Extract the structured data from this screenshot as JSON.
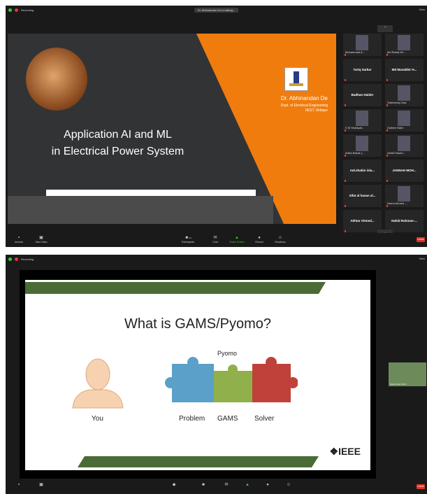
{
  "screens": [
    {
      "recording_label": "Recording",
      "meeting_title": "Dr. Abhinandan De is talking...",
      "view_label": "View",
      "slide": {
        "title_line1": "Application AI and ML",
        "title_line2": "in Electrical Power System",
        "author": "Dr. Abhinandan De",
        "dept_line1": "Dept. of Electrical Engineering",
        "dept_line2": "IIEST, Shibpur"
      },
      "participants": [
        {
          "name": "Mohammad A...",
          "video": true
        },
        {
          "name": "Md Rahat Kh...",
          "video": true
        },
        {
          "name": "Tariq Sarkar",
          "video": false
        },
        {
          "name": "Md Masabbir H...",
          "video": false
        },
        {
          "name": "Badhan Haider",
          "video": false
        },
        {
          "name": "Subhamoy Das",
          "video": true
        },
        {
          "name": "S M Shafayat...",
          "video": true
        },
        {
          "name": "Gulfam Naim",
          "video": true
        },
        {
          "name": "Aritra Basak (...",
          "video": true
        },
        {
          "name": "Zahid Hasan...",
          "video": true
        },
        {
          "name": "md.shabin isla...",
          "video": false
        },
        {
          "name": "JANNAH MOH...",
          "video": false
        },
        {
          "name": "Sifat al hasan al...",
          "video": false
        },
        {
          "name": "Sarna Ahmed ...",
          "video": true
        },
        {
          "name": "Akhtar Ahmed...",
          "video": false
        },
        {
          "name": "Nahid Rahman-...",
          "video": false
        }
      ],
      "toolbar": {
        "unmute": "Unmute",
        "video": "Start Video",
        "participants": "Participants",
        "participants_count": "23",
        "chat": "Chat",
        "share": "Share Screen",
        "record": "Record",
        "reactions": "Reactions",
        "end": "Leave"
      }
    },
    {
      "recording_label": "Recording",
      "view_label": "View",
      "slide": {
        "title": "What is GAMS/Pyomo?",
        "you": "You",
        "pyomo": "Pyomo",
        "problem": "Problem",
        "gams": "GAMS",
        "solver": "Solver",
        "ieee": "❖IEEE"
      },
      "thumb_name": "Samiul Alam Shir...",
      "toolbar": {
        "end": "Leave"
      }
    }
  ],
  "colors": {
    "orange": "#f07c0e",
    "slide_dark": "#323334",
    "green": "#4a6b35",
    "blue_piece": "#5aa0c8",
    "green_piece": "#8fb04a",
    "red_piece": "#c0413a"
  }
}
